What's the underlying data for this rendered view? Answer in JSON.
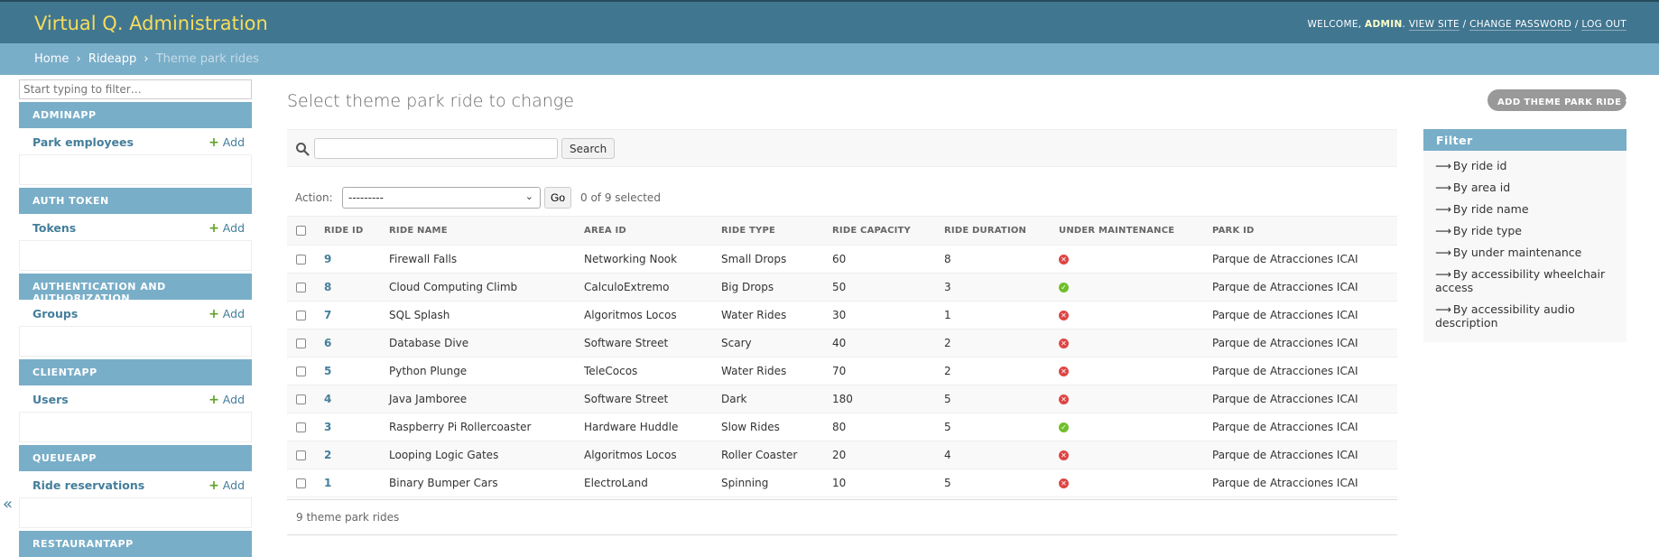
{
  "header": {
    "site_title": "Virtual Q. Administration",
    "welcome": "Welcome,",
    "username": "admin",
    "view_site": "View site",
    "change_password": "Change password",
    "log_out": "Log out"
  },
  "breadcrumbs": {
    "home": "Home",
    "app": "Rideapp",
    "current": "Theme park rides",
    "separator": "›"
  },
  "sidebar": {
    "filter_placeholder": "Start typing to filter…",
    "add_label": "Add",
    "modules": [
      {
        "caption": "Adminapp",
        "model": "Park employees"
      },
      {
        "caption": "Auth Token",
        "model": "Tokens"
      },
      {
        "caption": "Authentication and Authorization",
        "model": "Groups"
      },
      {
        "caption": "Clientapp",
        "model": "Users"
      },
      {
        "caption": "Queueapp",
        "model": "Ride reservations"
      },
      {
        "caption": "Restaurantapp",
        "model": ""
      }
    ],
    "toggle": "«"
  },
  "content": {
    "title": "Select theme park ride to change",
    "add_button": "Add theme park ride",
    "search_button": "Search",
    "action_label": "Action:",
    "action_selected": "---------",
    "go_button": "Go",
    "selected_count": "0 of 9 selected",
    "paginator": "9 theme park rides"
  },
  "table": {
    "columns": [
      "Ride ID",
      "Ride name",
      "Area ID",
      "Ride type",
      "Ride capacity",
      "Ride duration",
      "Under maintenance",
      "Park ID"
    ],
    "rows": [
      {
        "id": "9",
        "name": "Firewall Falls",
        "area": "Networking Nook",
        "type": "Small Drops",
        "capacity": "60",
        "duration": "8",
        "maintenance": false,
        "park": "Parque de Atracciones ICAI"
      },
      {
        "id": "8",
        "name": "Cloud Computing Climb",
        "area": "CalculoExtremo",
        "type": "Big Drops",
        "capacity": "50",
        "duration": "3",
        "maintenance": true,
        "park": "Parque de Atracciones ICAI"
      },
      {
        "id": "7",
        "name": "SQL Splash",
        "area": "Algoritmos Locos",
        "type": "Water Rides",
        "capacity": "30",
        "duration": "1",
        "maintenance": false,
        "park": "Parque de Atracciones ICAI"
      },
      {
        "id": "6",
        "name": "Database Dive",
        "area": "Software Street",
        "type": "Scary",
        "capacity": "40",
        "duration": "2",
        "maintenance": false,
        "park": "Parque de Atracciones ICAI"
      },
      {
        "id": "5",
        "name": "Python Plunge",
        "area": "TeleCocos",
        "type": "Water Rides",
        "capacity": "70",
        "duration": "2",
        "maintenance": false,
        "park": "Parque de Atracciones ICAI"
      },
      {
        "id": "4",
        "name": "Java Jamboree",
        "area": "Software Street",
        "type": "Dark",
        "capacity": "180",
        "duration": "5",
        "maintenance": false,
        "park": "Parque de Atracciones ICAI"
      },
      {
        "id": "3",
        "name": "Raspberry Pi Rollercoaster",
        "area": "Hardware Huddle",
        "type": "Slow Rides",
        "capacity": "80",
        "duration": "5",
        "maintenance": true,
        "park": "Parque de Atracciones ICAI"
      },
      {
        "id": "2",
        "name": "Looping Logic Gates",
        "area": "Algoritmos Locos",
        "type": "Roller Coaster",
        "capacity": "20",
        "duration": "4",
        "maintenance": false,
        "park": "Parque de Atracciones ICAI"
      },
      {
        "id": "1",
        "name": "Binary Bumper Cars",
        "area": "ElectroLand",
        "type": "Spinning",
        "capacity": "10",
        "duration": "5",
        "maintenance": false,
        "park": "Parque de Atracciones ICAI"
      }
    ]
  },
  "filter": {
    "title": "Filter",
    "arrow": "⟶",
    "items": [
      "By ride id",
      "By area id",
      "By ride name",
      "By ride type",
      "By under maintenance",
      "By accessibility wheelchair access",
      "By accessibility audio description"
    ]
  },
  "colors": {
    "header_bg": "#417690",
    "breadcrumb_bg": "#79aec8",
    "title_yellow": "#f5dd5d",
    "link": "#447e9b",
    "add_green": "#5fa225",
    "no_red": "#dd4646",
    "yes_green": "#70bf2b"
  },
  "icons": [
    "search-icon",
    "plus-icon",
    "chevron-down-icon",
    "check-circle-icon",
    "x-circle-icon",
    "collapse-icon"
  ]
}
